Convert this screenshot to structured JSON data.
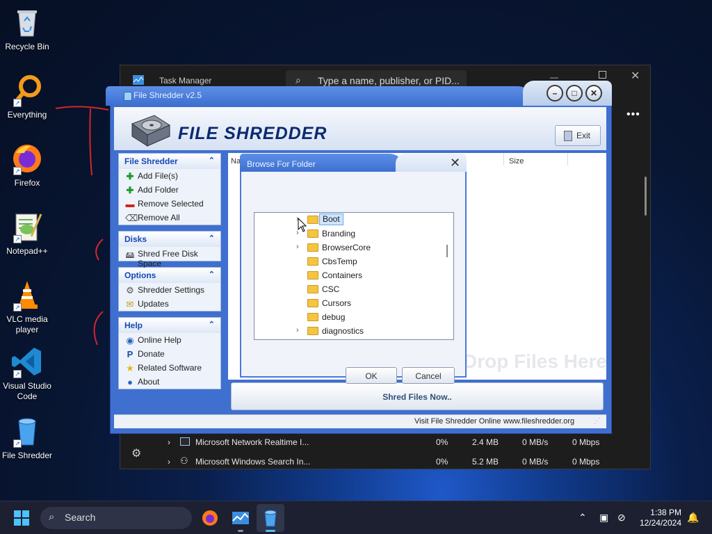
{
  "desktop": {
    "icons": [
      {
        "label": "Recycle Bin"
      },
      {
        "label": "Everything"
      },
      {
        "label": "Firefox"
      },
      {
        "label": "Notepad++"
      },
      {
        "label": "VLC media player"
      },
      {
        "label": "Visual Studio Code"
      },
      {
        "label": "File Shredder"
      }
    ]
  },
  "task_manager": {
    "title": "Task Manager",
    "search_placeholder": "Type a name, publisher, or PID...",
    "rows": [
      {
        "name": "Microsoft Network Realtime I...",
        "cpu": "0%",
        "memory": "2.4 MB",
        "disk": "0 MB/s",
        "network": "0 Mbps"
      },
      {
        "name": "Microsoft Windows Search In...",
        "cpu": "0%",
        "memory": "5.2 MB",
        "disk": "0 MB/s",
        "network": "0 Mbps"
      }
    ]
  },
  "file_shredder": {
    "window_title": "File Shredder v2.5",
    "logo_text": "FILE SHREDDER",
    "exit_label": "Exit",
    "panels": {
      "file_shredder": {
        "title": "File Shredder",
        "items": [
          "Add File(s)",
          "Add Folder",
          "Remove Selected",
          "Remove All"
        ]
      },
      "disks": {
        "title": "Disks",
        "items": [
          "Shred Free Disk Space"
        ]
      },
      "options": {
        "title": "Options",
        "items": [
          "Shredder Settings",
          "Updates"
        ]
      },
      "help": {
        "title": "Help",
        "items": [
          "Online Help",
          "Donate",
          "Related Software",
          "About"
        ]
      }
    },
    "columns": {
      "name": "Na",
      "size": "Size"
    },
    "drop_hint": "Drop Files Here",
    "shred_button": "Shred Files Now..",
    "status": {
      "visit": "Visit File Shredder Online",
      "url": "www.fileshredder.org"
    }
  },
  "browse_dialog": {
    "title": "Browse For Folder",
    "folders": [
      {
        "name": "Boot",
        "expandable": true,
        "selected": true
      },
      {
        "name": "Branding",
        "expandable": true,
        "selected": false
      },
      {
        "name": "BrowserCore",
        "expandable": true,
        "selected": false
      },
      {
        "name": "CbsTemp",
        "expandable": false,
        "selected": false
      },
      {
        "name": "Containers",
        "expandable": false,
        "selected": false
      },
      {
        "name": "CSC",
        "expandable": false,
        "selected": false
      },
      {
        "name": "Cursors",
        "expandable": false,
        "selected": false
      },
      {
        "name": "debug",
        "expandable": false,
        "selected": false
      },
      {
        "name": "diagnostics",
        "expandable": true,
        "selected": false
      }
    ],
    "ok_label": "OK",
    "cancel_label": "Cancel"
  },
  "taskbar": {
    "search_label": "Search",
    "time": "1:38 PM",
    "date": "12/24/2024"
  },
  "colors": {
    "accent": "#3f6fcf",
    "title_text": "#0a2a70"
  }
}
